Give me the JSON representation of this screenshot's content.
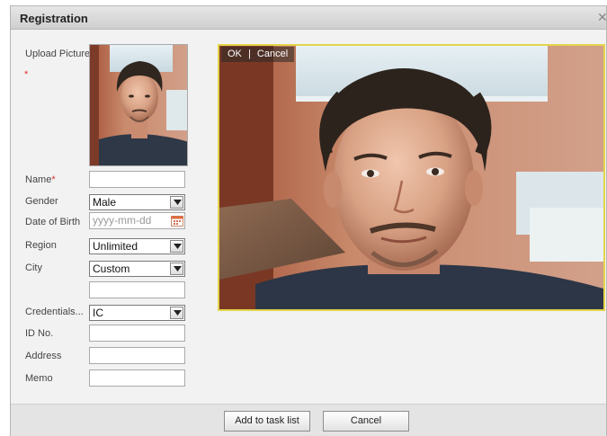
{
  "dialog": {
    "title": "Registration",
    "close_icon": "close-icon"
  },
  "form": {
    "upload_label": "Upload Picture",
    "name_label": "Name",
    "gender_label": "Gender",
    "gender_value": "Male",
    "dob_label": "Date of Birth",
    "dob_placeholder": "yyyy-mm-dd",
    "region_label": "Region",
    "region_value": "Unlimited",
    "city_label": "City",
    "city_value": "Custom",
    "credentials_label": "Credentials...",
    "credentials_value": "IC",
    "id_label": "ID No.",
    "address_label": "Address",
    "memo_label": "Memo"
  },
  "preview": {
    "ok_label": "OK",
    "separator": "|",
    "cancel_label": "Cancel"
  },
  "footer": {
    "add_label": "Add to task list",
    "cancel_label": "Cancel"
  },
  "colors": {
    "required": "#e0302c",
    "preview_border": "#e3d54b"
  }
}
